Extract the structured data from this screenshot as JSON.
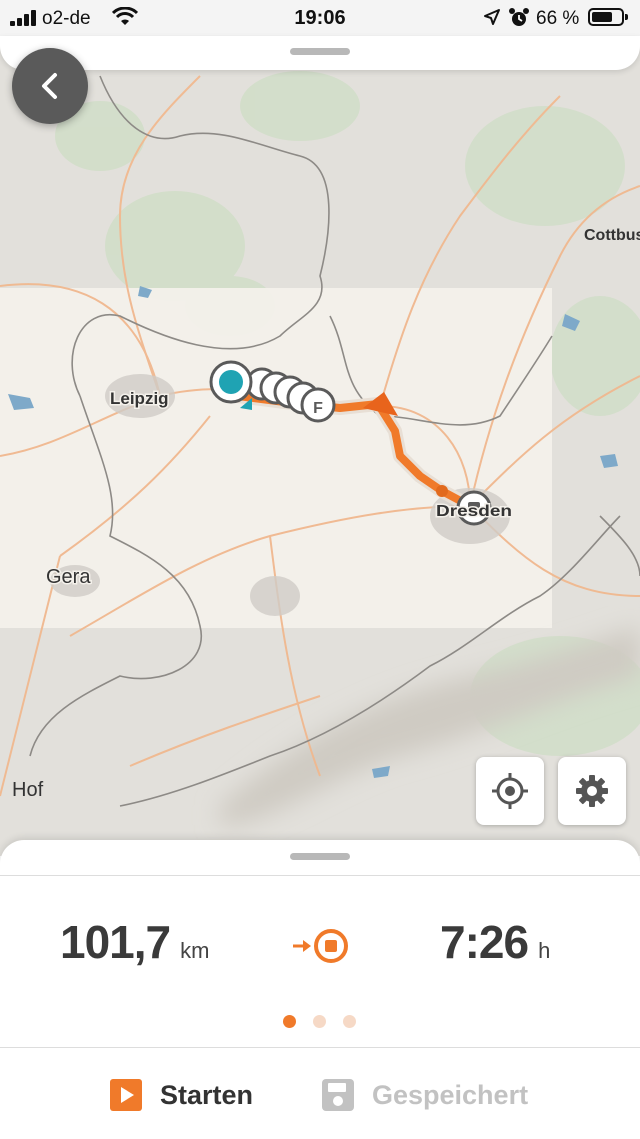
{
  "status_bar": {
    "carrier": "o2-de",
    "time": "19:06",
    "battery_percent": "66 %",
    "icons": [
      "signal-icon",
      "wifi-icon",
      "location-arrow-icon",
      "alarm-icon",
      "battery-icon"
    ]
  },
  "map": {
    "city_labels": {
      "leipzig": "Leipzig",
      "dresden": "Dresden",
      "gera": "Gera",
      "hof": "Hof",
      "cottbus": "Cottbus"
    },
    "waypoint_letter": "F",
    "colors": {
      "route": "#f07a2a",
      "start_marker": "#1fa3b3",
      "marker_ring": "#5a5a5a"
    }
  },
  "buttons": {
    "back": "back-chevron-icon",
    "locate": "crosshair-icon",
    "settings": "gear-icon"
  },
  "summary": {
    "distance_value": "101,7",
    "distance_unit": "km",
    "duration_value": "7:26",
    "duration_unit": "h",
    "destination_icon": "arrow-to-destination-icon",
    "page_count": 3,
    "active_page": 1
  },
  "actions": {
    "start_label": "Starten",
    "saved_label": "Gespeichert"
  },
  "theme": {
    "accent": "#f07a2a",
    "text_dark": "#3a3a3a",
    "disabled": "#c2c2c2"
  }
}
